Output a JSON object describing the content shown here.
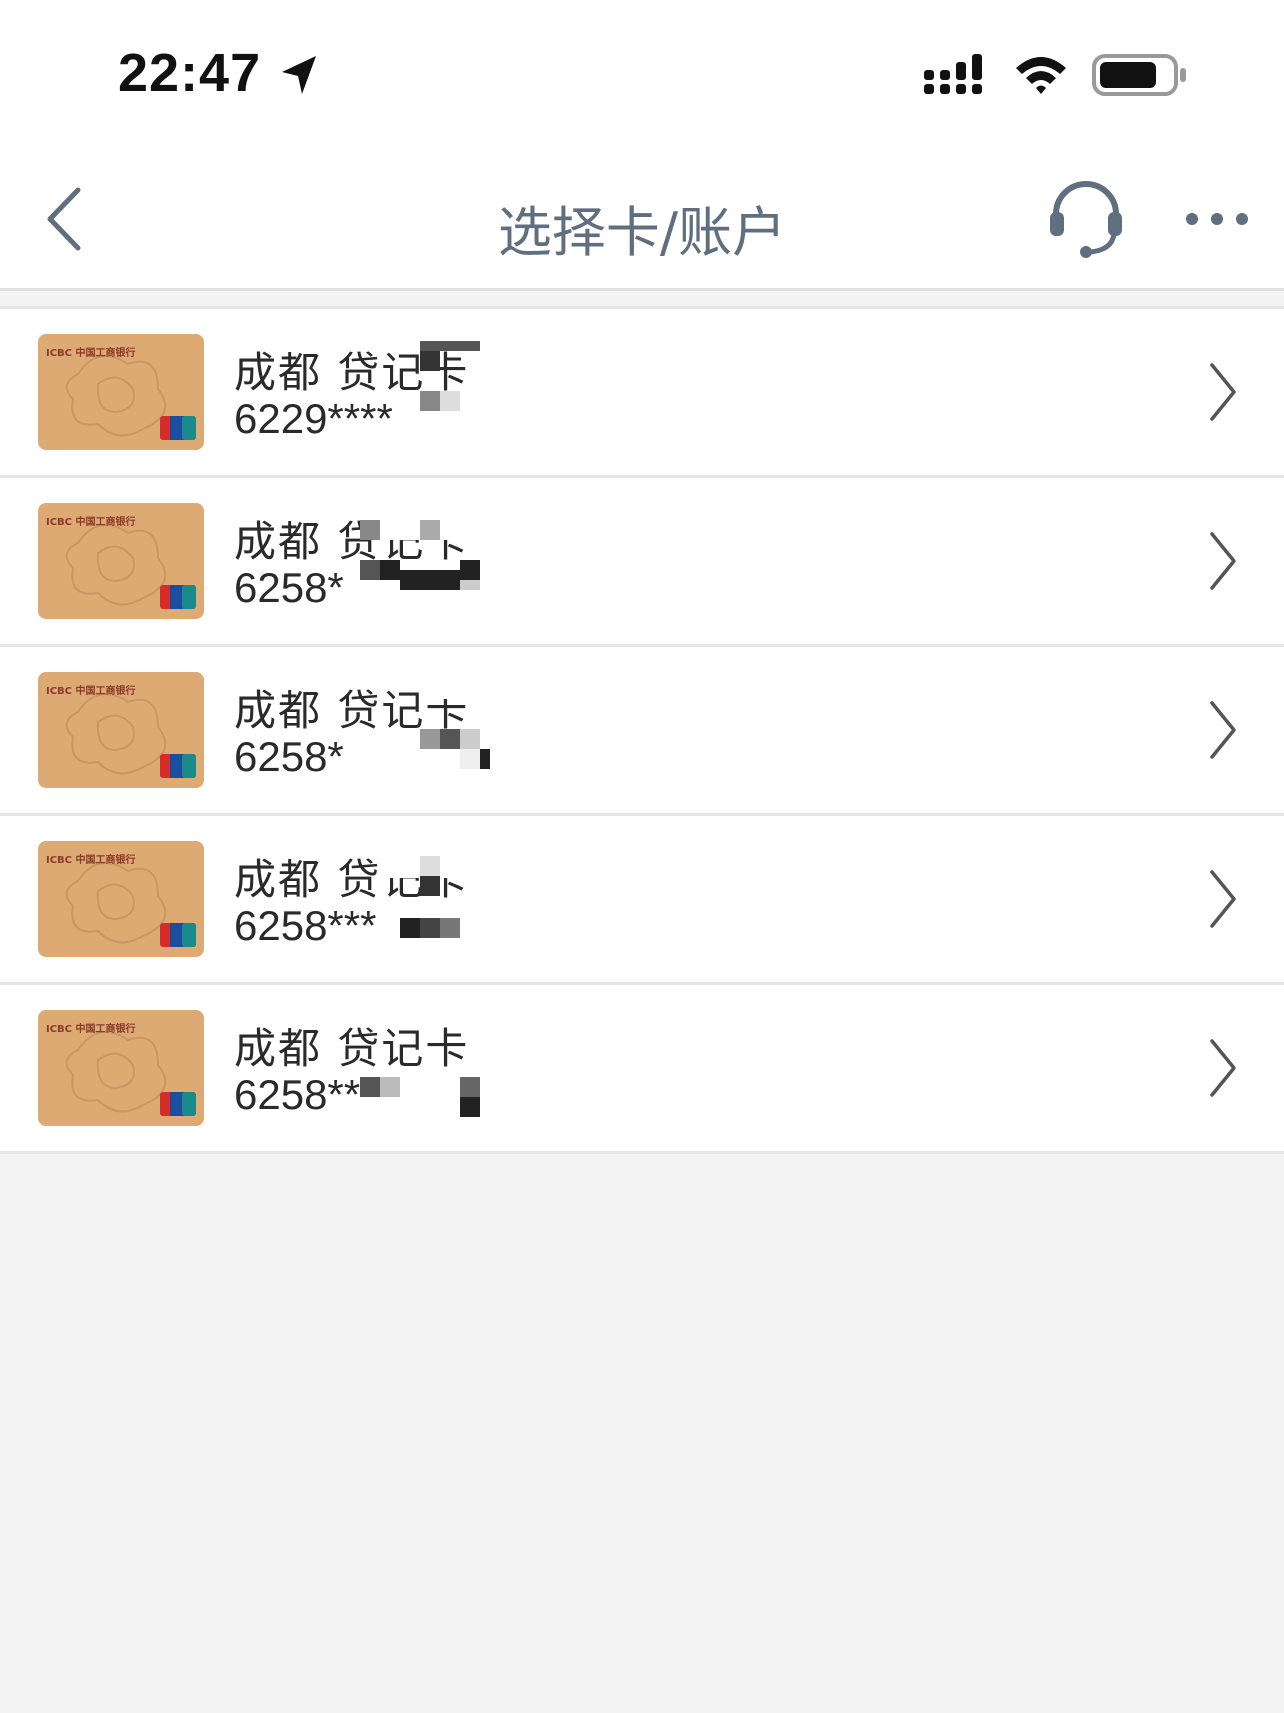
{
  "status_bar": {
    "time": "22:47"
  },
  "nav": {
    "title": "选择卡/账户"
  },
  "cards": [
    {
      "title": "成都  贷记卡",
      "number": "6229****"
    },
    {
      "title": "成都  贷记卡",
      "number": "6258*"
    },
    {
      "title": "成都  贷记卡",
      "number": "6258*"
    },
    {
      "title": "成都  贷记卡",
      "number": "6258***"
    },
    {
      "title": "成都  贷记卡",
      "number": "6258****"
    }
  ],
  "card_thumb": {
    "bank_mark": "ICBC 中国工商银行",
    "network_mark": "UnionPay 银联"
  },
  "colors": {
    "nav_title": "#5f6f80",
    "card_face": "#deaa74",
    "page_bg": "#f3f3f3"
  }
}
